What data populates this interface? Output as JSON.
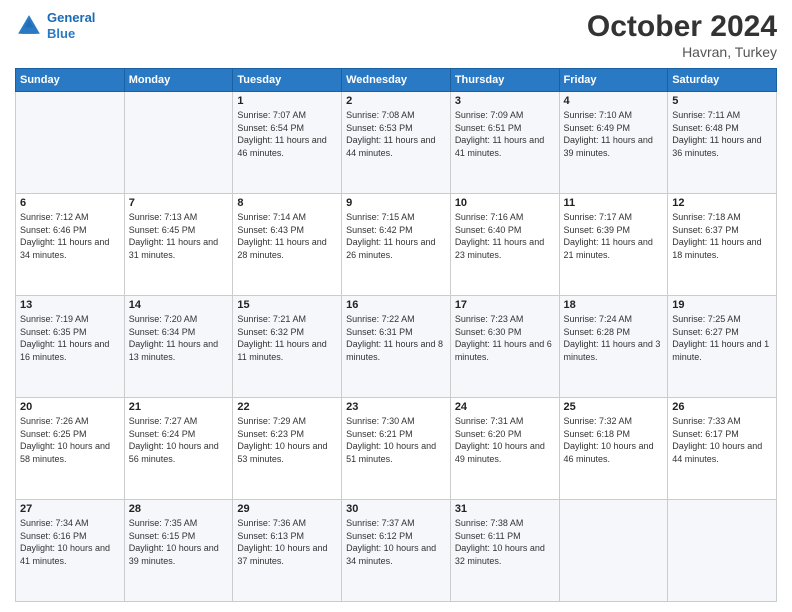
{
  "header": {
    "logo_line1": "General",
    "logo_line2": "Blue",
    "month": "October 2024",
    "location": "Havran, Turkey"
  },
  "weekdays": [
    "Sunday",
    "Monday",
    "Tuesday",
    "Wednesday",
    "Thursday",
    "Friday",
    "Saturday"
  ],
  "weeks": [
    [
      {
        "num": "",
        "detail": ""
      },
      {
        "num": "",
        "detail": ""
      },
      {
        "num": "1",
        "detail": "Sunrise: 7:07 AM\nSunset: 6:54 PM\nDaylight: 11 hours and 46 minutes."
      },
      {
        "num": "2",
        "detail": "Sunrise: 7:08 AM\nSunset: 6:53 PM\nDaylight: 11 hours and 44 minutes."
      },
      {
        "num": "3",
        "detail": "Sunrise: 7:09 AM\nSunset: 6:51 PM\nDaylight: 11 hours and 41 minutes."
      },
      {
        "num": "4",
        "detail": "Sunrise: 7:10 AM\nSunset: 6:49 PM\nDaylight: 11 hours and 39 minutes."
      },
      {
        "num": "5",
        "detail": "Sunrise: 7:11 AM\nSunset: 6:48 PM\nDaylight: 11 hours and 36 minutes."
      }
    ],
    [
      {
        "num": "6",
        "detail": "Sunrise: 7:12 AM\nSunset: 6:46 PM\nDaylight: 11 hours and 34 minutes."
      },
      {
        "num": "7",
        "detail": "Sunrise: 7:13 AM\nSunset: 6:45 PM\nDaylight: 11 hours and 31 minutes."
      },
      {
        "num": "8",
        "detail": "Sunrise: 7:14 AM\nSunset: 6:43 PM\nDaylight: 11 hours and 28 minutes."
      },
      {
        "num": "9",
        "detail": "Sunrise: 7:15 AM\nSunset: 6:42 PM\nDaylight: 11 hours and 26 minutes."
      },
      {
        "num": "10",
        "detail": "Sunrise: 7:16 AM\nSunset: 6:40 PM\nDaylight: 11 hours and 23 minutes."
      },
      {
        "num": "11",
        "detail": "Sunrise: 7:17 AM\nSunset: 6:39 PM\nDaylight: 11 hours and 21 minutes."
      },
      {
        "num": "12",
        "detail": "Sunrise: 7:18 AM\nSunset: 6:37 PM\nDaylight: 11 hours and 18 minutes."
      }
    ],
    [
      {
        "num": "13",
        "detail": "Sunrise: 7:19 AM\nSunset: 6:35 PM\nDaylight: 11 hours and 16 minutes."
      },
      {
        "num": "14",
        "detail": "Sunrise: 7:20 AM\nSunset: 6:34 PM\nDaylight: 11 hours and 13 minutes."
      },
      {
        "num": "15",
        "detail": "Sunrise: 7:21 AM\nSunset: 6:32 PM\nDaylight: 11 hours and 11 minutes."
      },
      {
        "num": "16",
        "detail": "Sunrise: 7:22 AM\nSunset: 6:31 PM\nDaylight: 11 hours and 8 minutes."
      },
      {
        "num": "17",
        "detail": "Sunrise: 7:23 AM\nSunset: 6:30 PM\nDaylight: 11 hours and 6 minutes."
      },
      {
        "num": "18",
        "detail": "Sunrise: 7:24 AM\nSunset: 6:28 PM\nDaylight: 11 hours and 3 minutes."
      },
      {
        "num": "19",
        "detail": "Sunrise: 7:25 AM\nSunset: 6:27 PM\nDaylight: 11 hours and 1 minute."
      }
    ],
    [
      {
        "num": "20",
        "detail": "Sunrise: 7:26 AM\nSunset: 6:25 PM\nDaylight: 10 hours and 58 minutes."
      },
      {
        "num": "21",
        "detail": "Sunrise: 7:27 AM\nSunset: 6:24 PM\nDaylight: 10 hours and 56 minutes."
      },
      {
        "num": "22",
        "detail": "Sunrise: 7:29 AM\nSunset: 6:23 PM\nDaylight: 10 hours and 53 minutes."
      },
      {
        "num": "23",
        "detail": "Sunrise: 7:30 AM\nSunset: 6:21 PM\nDaylight: 10 hours and 51 minutes."
      },
      {
        "num": "24",
        "detail": "Sunrise: 7:31 AM\nSunset: 6:20 PM\nDaylight: 10 hours and 49 minutes."
      },
      {
        "num": "25",
        "detail": "Sunrise: 7:32 AM\nSunset: 6:18 PM\nDaylight: 10 hours and 46 minutes."
      },
      {
        "num": "26",
        "detail": "Sunrise: 7:33 AM\nSunset: 6:17 PM\nDaylight: 10 hours and 44 minutes."
      }
    ],
    [
      {
        "num": "27",
        "detail": "Sunrise: 7:34 AM\nSunset: 6:16 PM\nDaylight: 10 hours and 41 minutes."
      },
      {
        "num": "28",
        "detail": "Sunrise: 7:35 AM\nSunset: 6:15 PM\nDaylight: 10 hours and 39 minutes."
      },
      {
        "num": "29",
        "detail": "Sunrise: 7:36 AM\nSunset: 6:13 PM\nDaylight: 10 hours and 37 minutes."
      },
      {
        "num": "30",
        "detail": "Sunrise: 7:37 AM\nSunset: 6:12 PM\nDaylight: 10 hours and 34 minutes."
      },
      {
        "num": "31",
        "detail": "Sunrise: 7:38 AM\nSunset: 6:11 PM\nDaylight: 10 hours and 32 minutes."
      },
      {
        "num": "",
        "detail": ""
      },
      {
        "num": "",
        "detail": ""
      }
    ]
  ]
}
